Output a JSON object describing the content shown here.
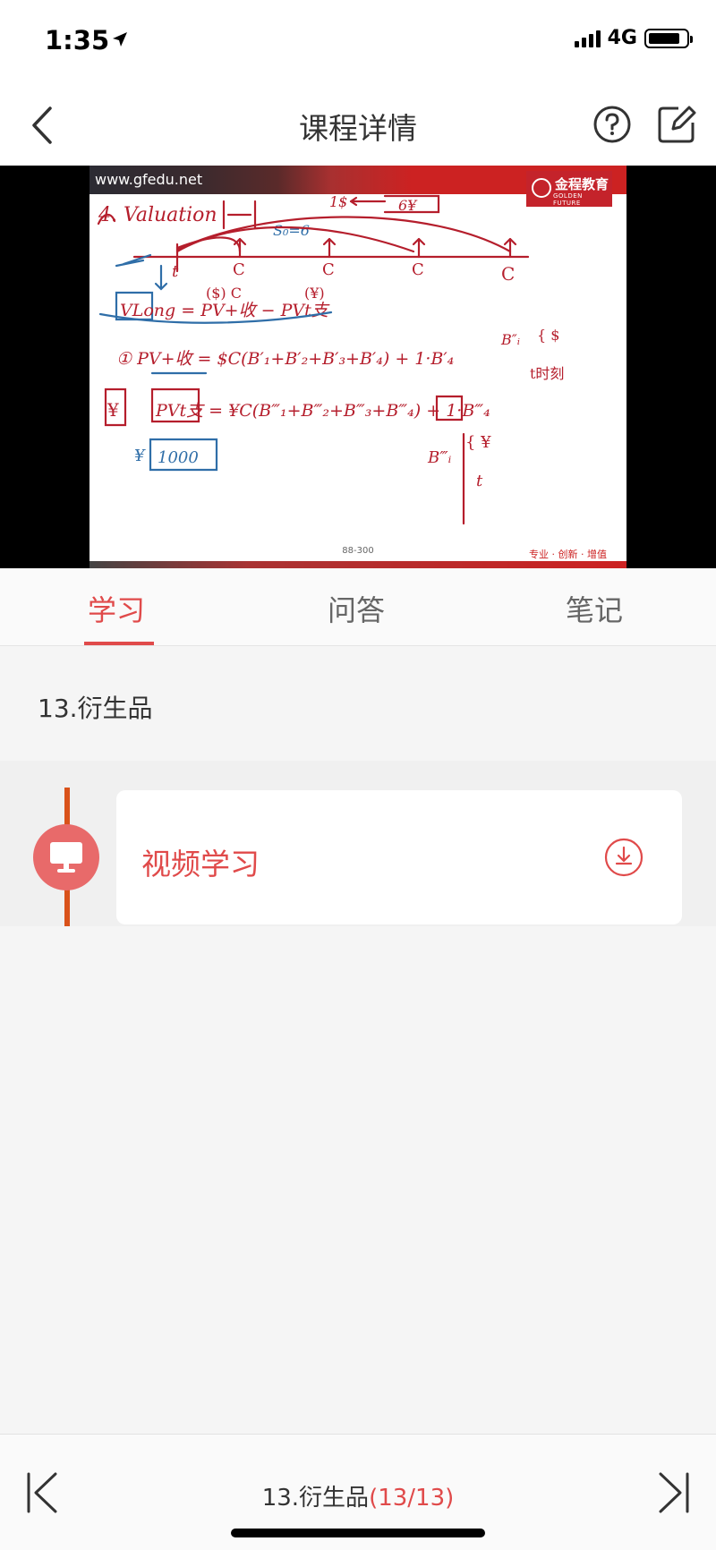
{
  "status_bar": {
    "time": "1:35",
    "network": "4G"
  },
  "nav": {
    "title": "课程详情"
  },
  "video": {
    "url_watermark": "www.gfedu.net",
    "logo_name": "金程教育",
    "logo_subtitle": "GOLDEN FUTURE",
    "page_number": "88-300",
    "tagline": "专业 · 创新 · 增值"
  },
  "tabs": [
    {
      "label": "学习",
      "active": true
    },
    {
      "label": "问答",
      "active": false
    },
    {
      "label": "笔记",
      "active": false
    }
  ],
  "section": {
    "title": "13.衍生品"
  },
  "lesson": {
    "label": "视频学习"
  },
  "footer": {
    "chapter": "13.衍生品",
    "count": "(13/13)"
  },
  "colors": {
    "accent": "#e04a4a",
    "timeline": "#d9521a",
    "icon_bg": "#e86a6a"
  }
}
